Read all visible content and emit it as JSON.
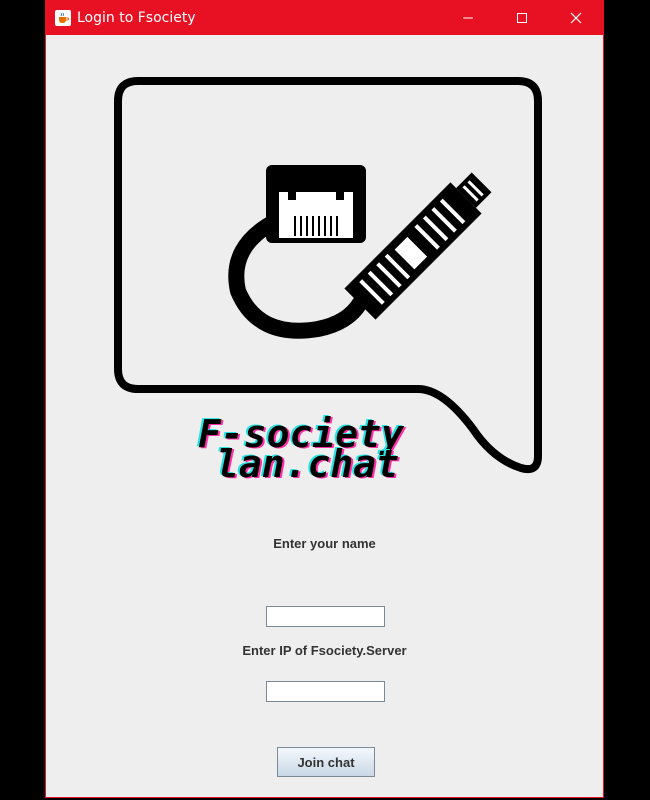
{
  "window": {
    "title": "Login to Fsociety"
  },
  "title_controls": {
    "minimize_icon": "minimize-icon",
    "maximize_icon": "maximize-icon",
    "close_icon": "close-icon"
  },
  "logo": {
    "line1": "F-society",
    "line2": "lan.chat"
  },
  "form": {
    "name_label": "Enter your name",
    "name_value": "",
    "ip_label": "Enter IP of Fsociety.Server",
    "ip_value": "",
    "join_label": "Join chat"
  },
  "colors": {
    "titlebar": "#e81123",
    "background": "#eeeeee",
    "logo_glitch_pink": "#ff2ea6",
    "logo_glitch_cyan": "#27e3e3"
  }
}
